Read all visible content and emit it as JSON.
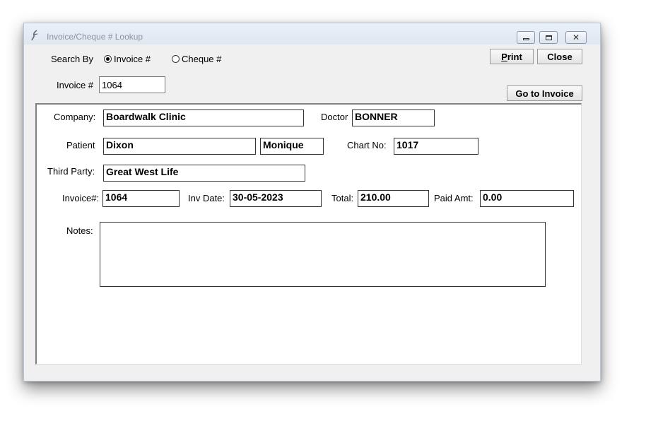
{
  "window": {
    "title": "Invoice/Cheque # Lookup",
    "controls": [
      "minimize",
      "maximize",
      "close"
    ]
  },
  "toolbar": {
    "print_label": "Print",
    "print_mnemonic": "P",
    "print_rest": "rint",
    "close_label": "Close",
    "go_to_invoice_label": "Go to Invoice"
  },
  "search": {
    "label": "Search By",
    "options": [
      {
        "label": "Invoice #",
        "selected": true
      },
      {
        "label": "Cheque #",
        "selected": false
      }
    ],
    "invoice_label": "Invoice #",
    "invoice_value": "1064"
  },
  "details": {
    "company_label": "Company:",
    "company": "Boardwalk Clinic",
    "doctor_label": "Doctor",
    "doctor": "BONNER",
    "patient_label": "Patient",
    "patient_last": "Dixon",
    "patient_first": "Monique",
    "chart_label": "Chart No:",
    "chart_no": "1017",
    "third_party_label": "Third Party:",
    "third_party": "Great West Life",
    "invoice_label": "Invoice#:",
    "invoice_no": "1064",
    "inv_date_label": "Inv Date:",
    "inv_date": "30-05-2023",
    "total_label": "Total:",
    "total": "210.00",
    "paid_label": "Paid Amt:",
    "paid_amt": "0.00",
    "notes_label": "Notes:",
    "notes": ""
  }
}
